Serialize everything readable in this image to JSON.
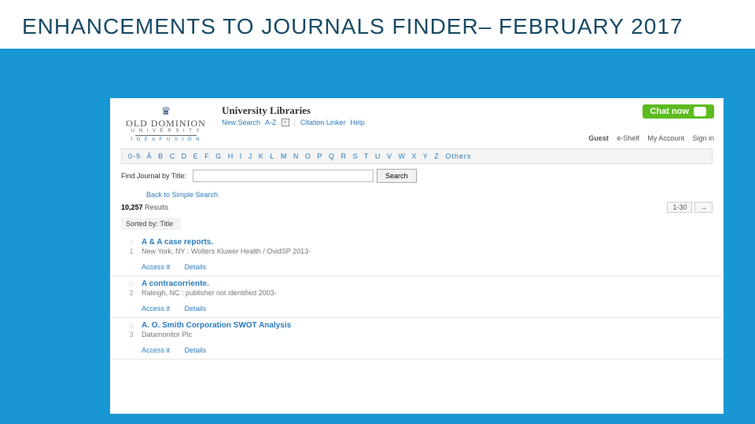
{
  "slide": {
    "title": "ENHANCEMENTS TO JOURNALS FINDER– FEBRUARY 2017"
  },
  "logo": {
    "top": "OLD DOMINION",
    "sub": "U N I V E R S I T Y",
    "tag": "I D E A  F U S I O N"
  },
  "header": {
    "library_name": "University Libraries",
    "tabs": {
      "new_search": "New Search",
      "az": "A-Z",
      "citation": "Citation Linker",
      "help": "Help"
    },
    "chat": "Chat now",
    "user": {
      "guest": "Guest",
      "eshelf": "e-Shelf",
      "account": "My Account",
      "signin": "Sign in"
    }
  },
  "az": [
    "0-9",
    "Ä",
    "B",
    "C",
    "D",
    "E",
    "F",
    "G",
    "H",
    "I",
    "J",
    "K",
    "L",
    "M",
    "N",
    "O",
    "P",
    "Q",
    "R",
    "S",
    "T",
    "U",
    "V",
    "W",
    "X",
    "Y",
    "Z",
    "Others"
  ],
  "search": {
    "label": "Find Journal by Title:",
    "button": "Search"
  },
  "back": "Back to Simple Search",
  "count": {
    "n": "10,257",
    "word": "Results"
  },
  "range": {
    "text": "1-30",
    "next": "→"
  },
  "sort": {
    "label": "Sorted by:",
    "value": "Title"
  },
  "results": [
    {
      "idx": "1",
      "title": "A & A case reports.",
      "pub": "New York, NY : Wolters Kluwer Health / OvidSP 2013-"
    },
    {
      "idx": "2",
      "title": "A contracorriente.",
      "pub": "Raleigh, NC : publisher not identified 2003-"
    },
    {
      "idx": "3",
      "title": "A. O. Smith Corporation SWOT Analysis",
      "pub": "Datamonitor Plc"
    }
  ],
  "links": {
    "access": "Access it",
    "details": "Details"
  }
}
